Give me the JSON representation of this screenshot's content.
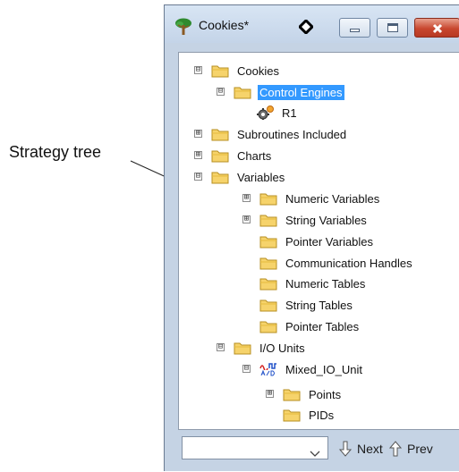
{
  "callout": {
    "label": "Strategy tree"
  },
  "window": {
    "title": "Cookies*",
    "icons": {
      "app": "tree-icon",
      "pin": "diamond-icon"
    }
  },
  "tree": {
    "nodes": [
      {
        "label": "Cookies",
        "icon": "folder-icon",
        "expander": "⊟"
      },
      {
        "label": "Control Engines",
        "icon": "folder-icon",
        "expander": "⊟",
        "selected": true
      },
      {
        "label": "R1",
        "icon": "gear-icon"
      },
      {
        "label": "Subroutines Included",
        "icon": "folder-icon",
        "expander": "⊞"
      },
      {
        "label": "Charts",
        "icon": "folder-icon",
        "expander": "⊞"
      },
      {
        "label": "Variables",
        "icon": "folder-icon",
        "expander": "⊟"
      },
      {
        "label": "Numeric Variables",
        "icon": "folder-icon",
        "expander": "⊞"
      },
      {
        "label": "String Variables",
        "icon": "folder-icon",
        "expander": "⊞"
      },
      {
        "label": "Pointer Variables",
        "icon": "folder-icon"
      },
      {
        "label": "Communication Handles",
        "icon": "folder-icon"
      },
      {
        "label": "Numeric Tables",
        "icon": "folder-icon"
      },
      {
        "label": "String Tables",
        "icon": "folder-icon"
      },
      {
        "label": "Pointer Tables",
        "icon": "folder-icon"
      },
      {
        "label": "I/O Units",
        "icon": "folder-icon",
        "expander": "⊟"
      },
      {
        "label": "Mixed_IO_Unit",
        "icon": "io-unit-icon",
        "expander": "⊟"
      },
      {
        "label": "Points",
        "icon": "folder-icon",
        "expander": "⊞"
      },
      {
        "label": "PIDs",
        "icon": "folder-icon"
      }
    ]
  },
  "bottom": {
    "search_value": "",
    "next_label": "Next",
    "prev_label": "Prev"
  },
  "colors": {
    "selection": "#3399ff",
    "folder": "#f6d36b",
    "close_button": "#c8472f"
  }
}
